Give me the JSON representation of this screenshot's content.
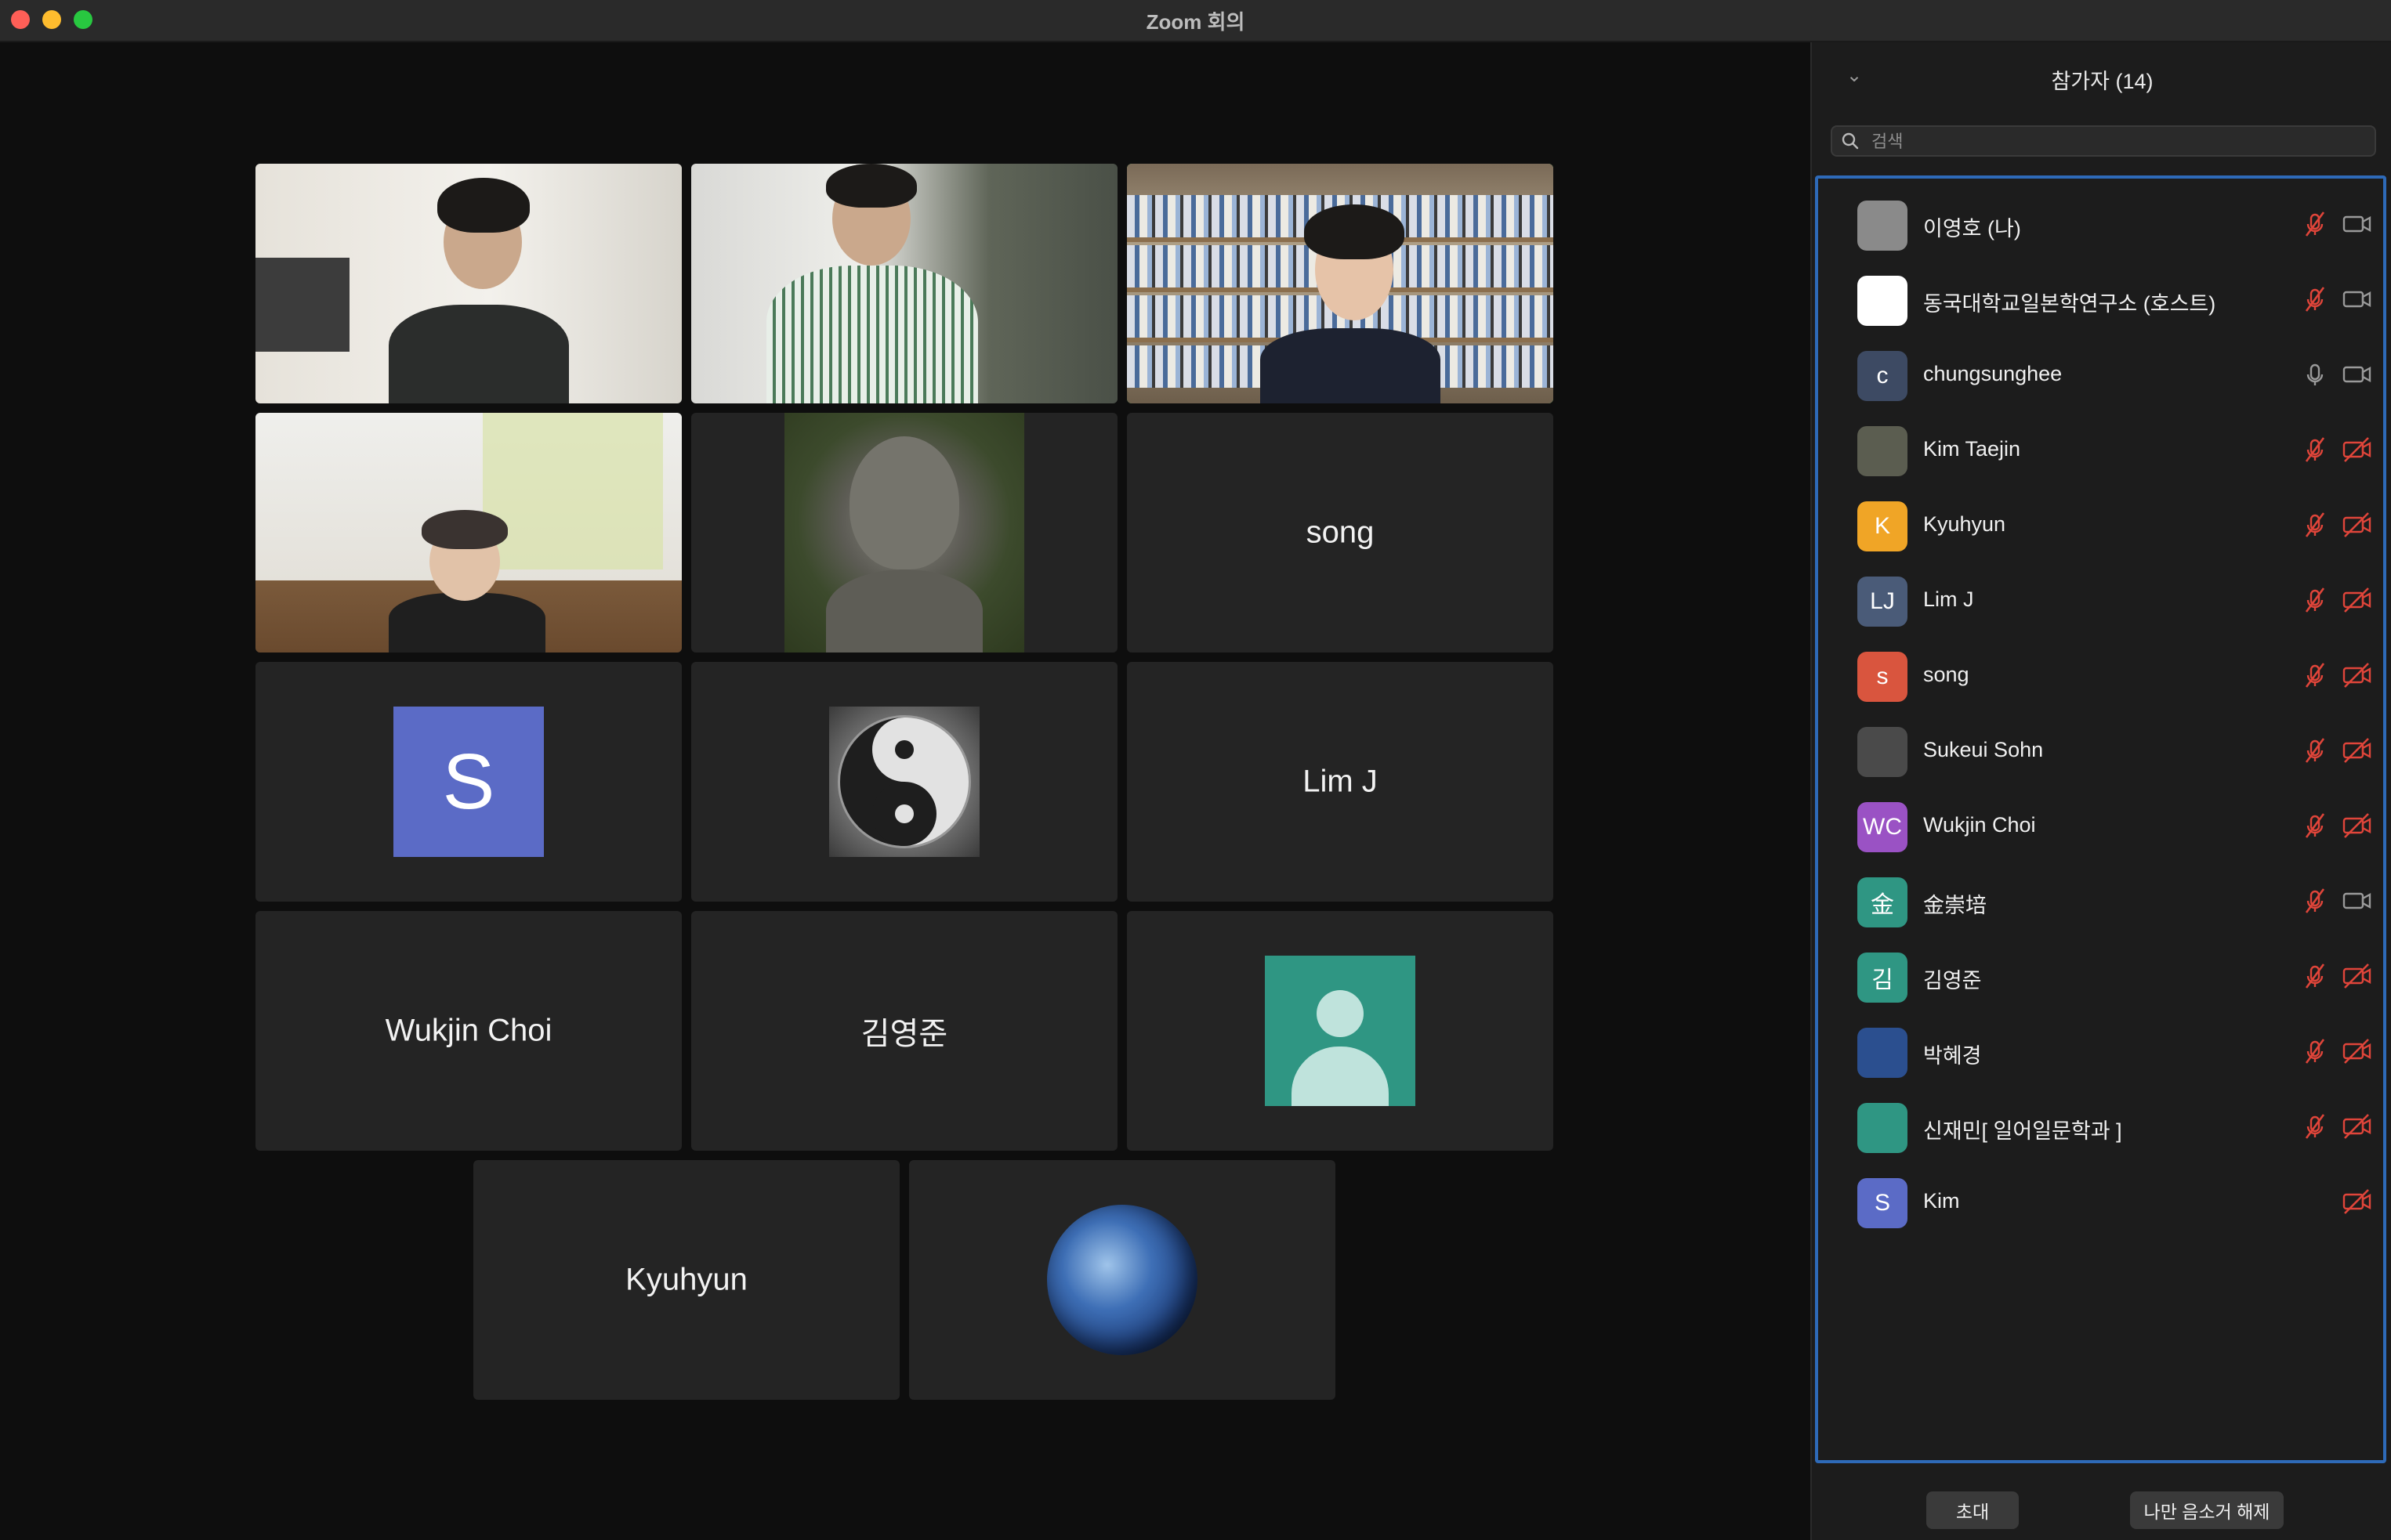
{
  "window": {
    "title": "Zoom 회의"
  },
  "gallery": {
    "tiles": [
      {
        "kind": "video",
        "label": ""
      },
      {
        "kind": "video",
        "label": ""
      },
      {
        "kind": "video",
        "label": ""
      },
      {
        "kind": "video",
        "label": ""
      },
      {
        "kind": "image",
        "label": ""
      },
      {
        "kind": "name",
        "label": "song"
      },
      {
        "kind": "avatar",
        "label": "S"
      },
      {
        "kind": "image",
        "label": ""
      },
      {
        "kind": "name",
        "label": "Lim J"
      },
      {
        "kind": "name",
        "label": "Wukjin Choi"
      },
      {
        "kind": "name",
        "label": "김영준"
      },
      {
        "kind": "avatar",
        "label": ""
      },
      {
        "kind": "name",
        "label": "Kyuhyun"
      },
      {
        "kind": "image",
        "label": ""
      }
    ],
    "active_speaker_index": 2
  },
  "panel": {
    "title": "참가자 (14)",
    "search": {
      "placeholder": "검색",
      "value": ""
    },
    "participants": [
      {
        "name": "이영호 (나)",
        "avatar_text": "",
        "avatar_color": "#8a8a8a",
        "mic": "muted",
        "video": "on"
      },
      {
        "name": "동국대학교일본학연구소 (호스트)",
        "avatar_text": "",
        "avatar_color": "#ffffff",
        "mic": "muted",
        "video": "on"
      },
      {
        "name": "chungsunghee",
        "avatar_text": "c",
        "avatar_color": "#3d4a63",
        "mic": "on",
        "video": "on"
      },
      {
        "name": "Kim Taejin",
        "avatar_text": "",
        "avatar_color": "#5b5d50",
        "mic": "muted",
        "video": "off"
      },
      {
        "name": "Kyuhyun",
        "avatar_text": "K",
        "avatar_color": "#f0a526",
        "mic": "muted",
        "video": "off"
      },
      {
        "name": "Lim J",
        "avatar_text": "LJ",
        "avatar_color": "#4a5b78",
        "mic": "muted",
        "video": "off"
      },
      {
        "name": "song",
        "avatar_text": "s",
        "avatar_color": "#d9553e",
        "mic": "muted",
        "video": "off"
      },
      {
        "name": "Sukeui Sohn",
        "avatar_text": "",
        "avatar_color": "#4a4a4a",
        "mic": "muted",
        "video": "off"
      },
      {
        "name": "Wukjin Choi",
        "avatar_text": "WC",
        "avatar_color": "#9a52c4",
        "mic": "muted",
        "video": "off"
      },
      {
        "name": "金崇培",
        "avatar_text": "金",
        "avatar_color": "#2f9683",
        "mic": "muted",
        "video": "on"
      },
      {
        "name": "김영준",
        "avatar_text": "김",
        "avatar_color": "#2f9683",
        "mic": "muted",
        "video": "off"
      },
      {
        "name": "박혜경",
        "avatar_text": "",
        "avatar_color": "#2b4f8f",
        "mic": "muted",
        "video": "off"
      },
      {
        "name": "신재민[ 일어일문학과 ]",
        "avatar_text": "",
        "avatar_color": "#2f9683",
        "mic": "muted",
        "video": "off"
      },
      {
        "name": "Kim",
        "avatar_text": "S",
        "avatar_color": "#5b6bc6",
        "mic": "none",
        "video": "off"
      }
    ],
    "buttons": {
      "invite": "초대",
      "unmute_me": "나만 음소거 해제"
    }
  },
  "colors": {
    "active_speaker_outline": "#34c759",
    "muted_icon": "#e0453a",
    "list_focus_border": "#2e6ab8"
  }
}
